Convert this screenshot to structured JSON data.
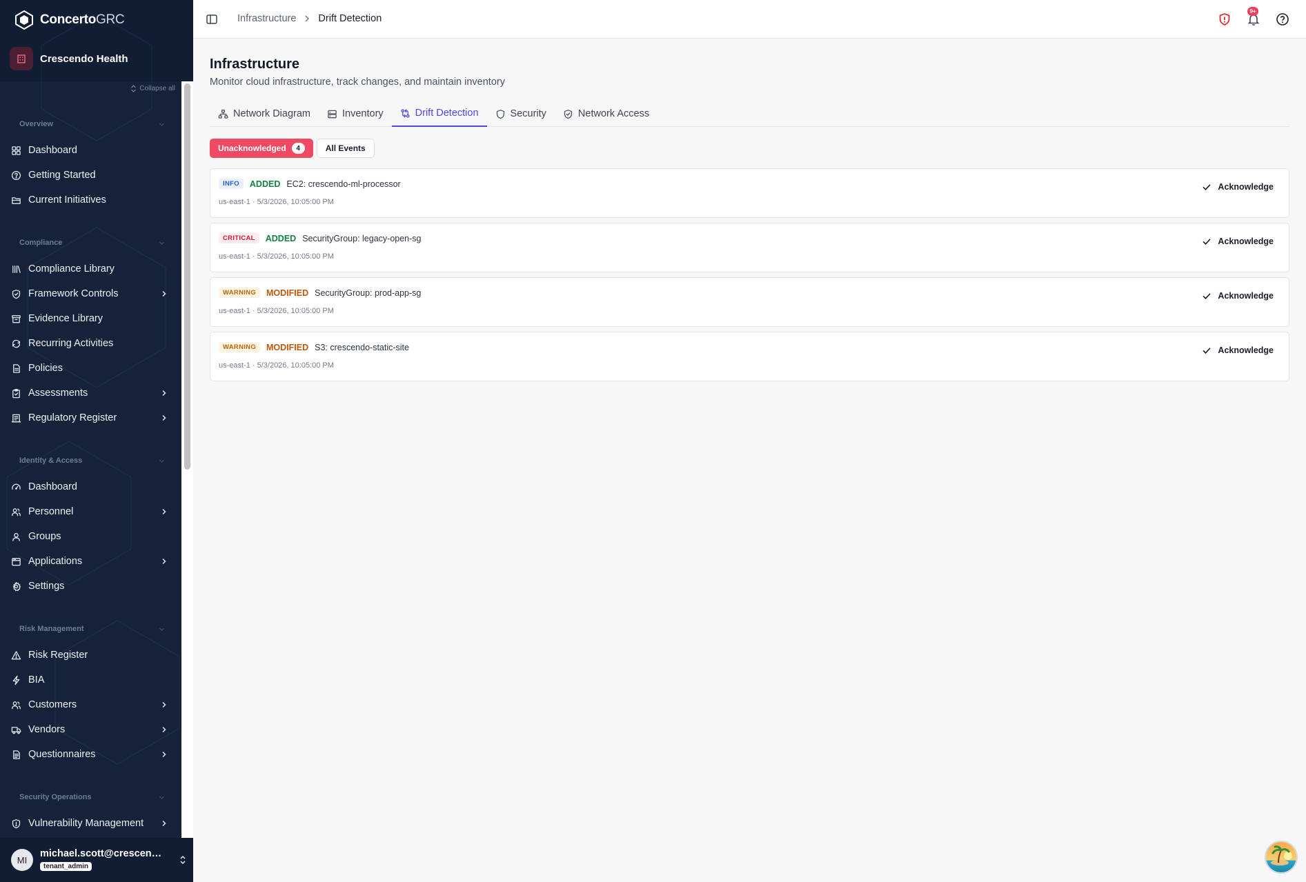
{
  "app": {
    "brand_bold": "Concerto",
    "brand_light": "GRC",
    "org_name": "Crescendo Health",
    "collapse_all": "Collapse all"
  },
  "sidebar": {
    "sections": [
      {
        "title": "Overview",
        "items": [
          {
            "label": "Dashboard",
            "icon": "dashboard-icon",
            "chevron": false
          },
          {
            "label": "Getting Started",
            "icon": "help-circle-icon",
            "chevron": false
          },
          {
            "label": "Current Initiatives",
            "icon": "folder-icon",
            "chevron": false
          }
        ]
      },
      {
        "title": "Compliance",
        "items": [
          {
            "label": "Compliance Library",
            "icon": "library-icon",
            "chevron": false
          },
          {
            "label": "Framework Controls",
            "icon": "shield-check-icon",
            "chevron": true
          },
          {
            "label": "Evidence Library",
            "icon": "archive-icon",
            "chevron": false
          },
          {
            "label": "Recurring Activities",
            "icon": "refresh-icon",
            "chevron": false
          },
          {
            "label": "Policies",
            "icon": "document-icon",
            "chevron": false
          },
          {
            "label": "Assessments",
            "icon": "clipboard-check-icon",
            "chevron": true
          },
          {
            "label": "Regulatory Register",
            "icon": "register-icon",
            "chevron": true
          }
        ]
      },
      {
        "title": "Identity & Access",
        "items": [
          {
            "label": "Dashboard",
            "icon": "gauge-icon",
            "chevron": false
          },
          {
            "label": "Personnel",
            "icon": "users-icon",
            "chevron": true
          },
          {
            "label": "Groups",
            "icon": "user-group-icon",
            "chevron": false
          },
          {
            "label": "Applications",
            "icon": "app-window-icon",
            "chevron": true
          },
          {
            "label": "Settings",
            "icon": "gear-icon",
            "chevron": false
          }
        ]
      },
      {
        "title": "Risk Management",
        "items": [
          {
            "label": "Risk Register",
            "icon": "warning-triangle-icon",
            "chevron": false
          },
          {
            "label": "BIA",
            "icon": "lightning-icon",
            "chevron": false
          },
          {
            "label": "Customers",
            "icon": "customers-icon",
            "chevron": true
          },
          {
            "label": "Vendors",
            "icon": "truck-icon",
            "chevron": true
          },
          {
            "label": "Questionnaires",
            "icon": "questionnaire-icon",
            "chevron": true
          }
        ]
      },
      {
        "title": "Security Operations",
        "items": [
          {
            "label": "Vulnerability Management",
            "icon": "shield-alert-icon",
            "chevron": true
          }
        ]
      }
    ]
  },
  "user": {
    "initials": "MI",
    "email": "michael.scott@crescendohealth.com",
    "role": "tenant_admin"
  },
  "header": {
    "breadcrumb_parent": "Infrastructure",
    "breadcrumb_current": "Drift Detection",
    "notification_count": "9+"
  },
  "page": {
    "title": "Infrastructure",
    "subtitle": "Monitor cloud infrastructure, track changes, and maintain inventory"
  },
  "tabs": [
    {
      "label": "Network Diagram",
      "icon": "network-icon",
      "active": false
    },
    {
      "label": "Inventory",
      "icon": "server-icon",
      "active": false
    },
    {
      "label": "Drift Detection",
      "icon": "git-compare-icon",
      "active": true
    },
    {
      "label": "Security",
      "icon": "shield-icon",
      "active": false
    },
    {
      "label": "Network Access",
      "icon": "shield-check-icon",
      "active": false
    }
  ],
  "filters": {
    "unacknowledged_label": "Unacknowledged",
    "unacknowledged_count": "4",
    "all_events_label": "All Events"
  },
  "events": [
    {
      "severity": "INFO",
      "severity_class": "info",
      "change": "ADDED",
      "change_class": "added",
      "resource": "EC2: crescendo-ml-processor",
      "meta": "us-east-1 · 5/3/2026, 10:05:00 PM",
      "action": "Acknowledge"
    },
    {
      "severity": "CRITICAL",
      "severity_class": "critical",
      "change": "ADDED",
      "change_class": "added",
      "resource": "SecurityGroup: legacy-open-sg",
      "meta": "us-east-1 · 5/3/2026, 10:05:00 PM",
      "action": "Acknowledge"
    },
    {
      "severity": "WARNING",
      "severity_class": "warning",
      "change": "MODIFIED",
      "change_class": "modified",
      "resource": "SecurityGroup: prod-app-sg",
      "meta": "us-east-1 · 5/3/2026, 10:05:00 PM",
      "action": "Acknowledge"
    },
    {
      "severity": "WARNING",
      "severity_class": "warning",
      "change": "MODIFIED",
      "change_class": "modified",
      "resource": "S3: crescendo-static-site",
      "meta": "us-east-1 · 5/3/2026, 10:05:00 PM",
      "action": "Acknowledge"
    }
  ],
  "colors": {
    "sidebar_bg": "#101d33",
    "accent": "#4f46e5",
    "primary_pill": "#ef4a63",
    "added": "#15803d",
    "modified": "#c2570c"
  }
}
